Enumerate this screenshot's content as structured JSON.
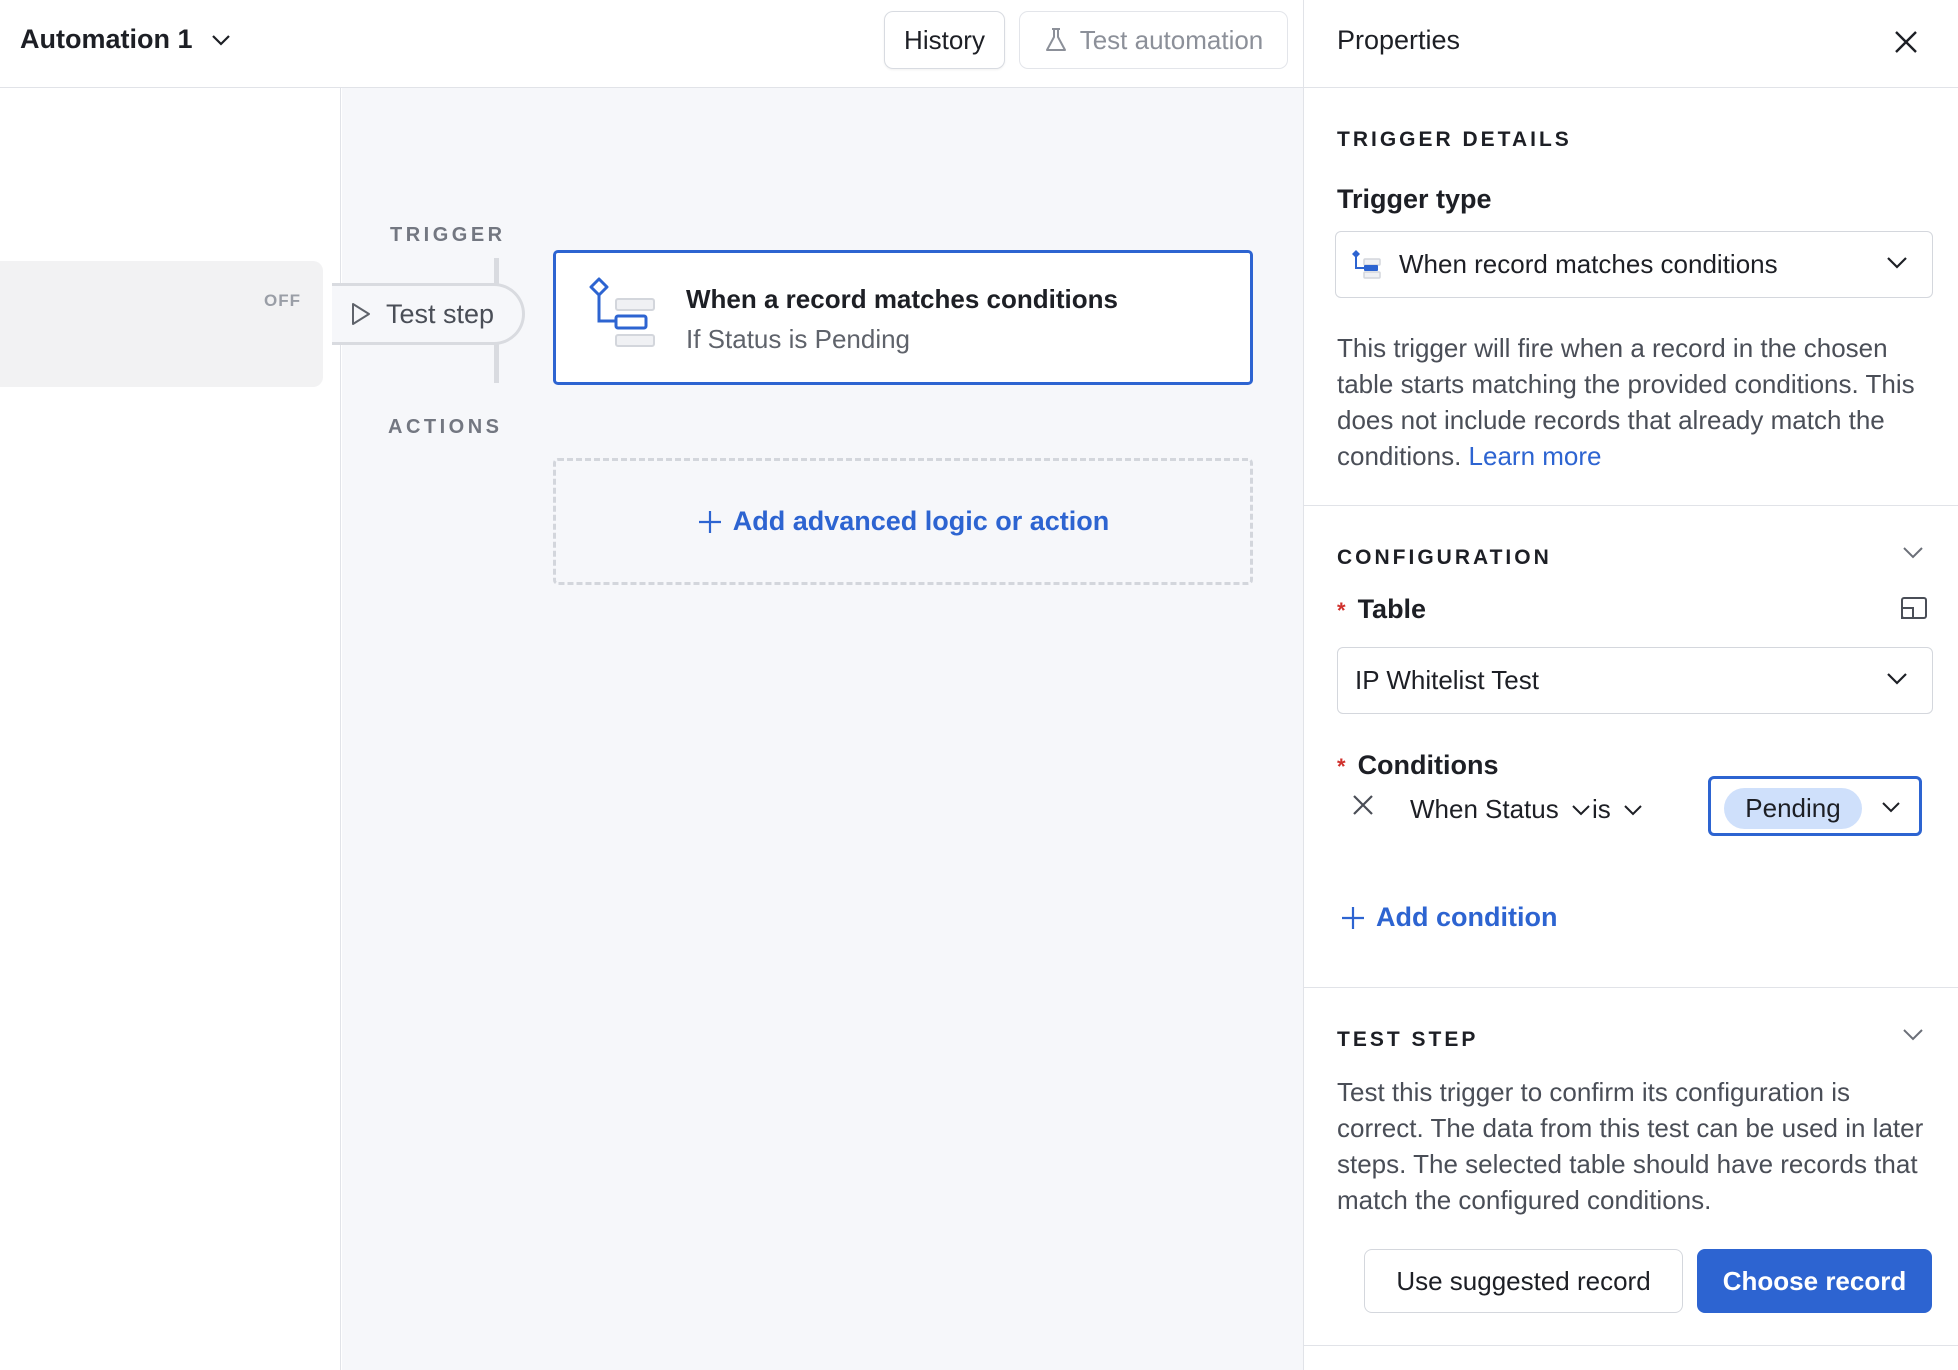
{
  "topbar": {
    "automation_name": "Automation 1",
    "history_label": "History",
    "test_automation_label": "Test automation"
  },
  "sidebar": {
    "status": "OFF"
  },
  "canvas": {
    "trigger_label": "TRIGGER",
    "actions_label": "ACTIONS",
    "test_step_label": "Test step",
    "trigger_card": {
      "title": "When a record matches conditions",
      "subtitle": "If Status is Pending"
    },
    "add_action_label": "Add advanced logic or action"
  },
  "properties": {
    "title": "Properties",
    "trigger_details": {
      "section_title": "TRIGGER DETAILS",
      "trigger_type_label": "Trigger type",
      "trigger_type_value": "When record matches conditions",
      "description": "This trigger will fire when a record in the chosen table starts matching the provided conditions. This does not include records that already match the conditions.",
      "learn_more": "Learn more"
    },
    "configuration": {
      "section_title": "CONFIGURATION",
      "required_marker": "*",
      "table_label": "Table",
      "table_value": "IP Whitelist Test",
      "conditions_label": "Conditions",
      "condition": {
        "when": "When",
        "field": "Status",
        "operator": "is",
        "value": "Pending"
      },
      "add_condition_label": "Add condition"
    },
    "test_step": {
      "section_title": "TEST STEP",
      "description": "Test this trigger to confirm its configuration is correct. The data from this test can be used in later steps. The selected table should have records that match the configured conditions.",
      "use_suggested_label": "Use suggested record",
      "choose_record_label": "Choose record"
    }
  },
  "colors": {
    "accent": "#2d64d1",
    "canvas_bg": "#f6f7fa",
    "pill_bg": "#cfe0fb",
    "required": "#d0312d"
  }
}
